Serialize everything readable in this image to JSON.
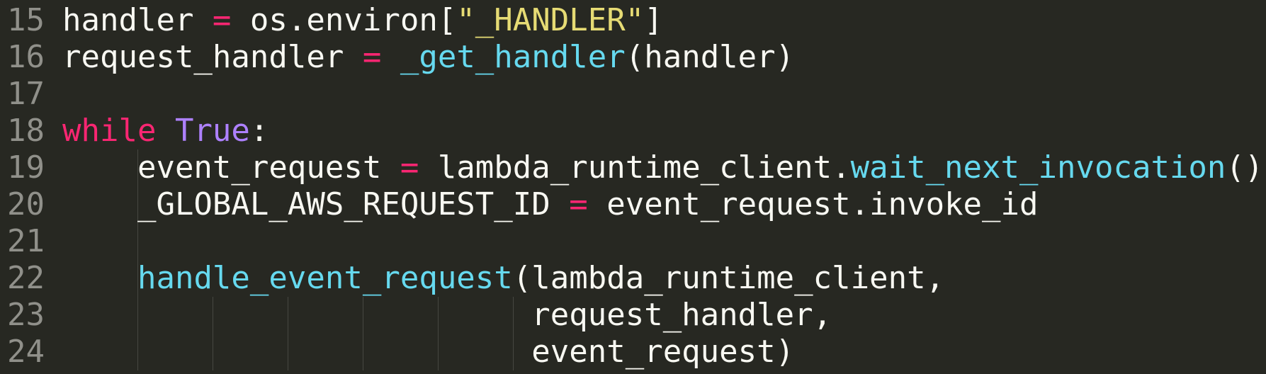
{
  "editor": {
    "theme_colors": {
      "background": "#272822",
      "keyword": "#f92672",
      "constant": "#ae81ff",
      "function": "#66d9ef",
      "string": "#e6db74",
      "text": "#f8f8f2",
      "gutter": "#90908a"
    },
    "lines": [
      {
        "number": "15",
        "guides": 0,
        "tokens": [
          {
            "t": "plain",
            "v": "handler "
          },
          {
            "t": "op",
            "v": "="
          },
          {
            "t": "plain",
            "v": " os.environ["
          },
          {
            "t": "str",
            "v": "\"_HANDLER\""
          },
          {
            "t": "plain",
            "v": "]"
          }
        ]
      },
      {
        "number": "16",
        "guides": 0,
        "tokens": [
          {
            "t": "plain",
            "v": "request_handler "
          },
          {
            "t": "op",
            "v": "="
          },
          {
            "t": "plain",
            "v": " "
          },
          {
            "t": "fn",
            "v": "_get_handler"
          },
          {
            "t": "plain",
            "v": "(handler)"
          }
        ]
      },
      {
        "number": "17",
        "guides": 0,
        "tokens": []
      },
      {
        "number": "18",
        "guides": 0,
        "tokens": [
          {
            "t": "kw",
            "v": "while"
          },
          {
            "t": "plain",
            "v": " "
          },
          {
            "t": "const",
            "v": "True"
          },
          {
            "t": "plain",
            "v": ":"
          }
        ]
      },
      {
        "number": "19",
        "guides": 1,
        "tokens": [
          {
            "t": "plain",
            "v": "    event_request "
          },
          {
            "t": "op",
            "v": "="
          },
          {
            "t": "plain",
            "v": " lambda_runtime_client."
          },
          {
            "t": "fn",
            "v": "wait_next_invocation"
          },
          {
            "t": "plain",
            "v": "()"
          }
        ]
      },
      {
        "number": "20",
        "guides": 1,
        "tokens": [
          {
            "t": "plain",
            "v": "    _GLOBAL_AWS_REQUEST_ID "
          },
          {
            "t": "op",
            "v": "="
          },
          {
            "t": "plain",
            "v": " event_request.invoke_id"
          }
        ]
      },
      {
        "number": "21",
        "guides": 1,
        "tokens": []
      },
      {
        "number": "22",
        "guides": 1,
        "tokens": [
          {
            "t": "plain",
            "v": "    "
          },
          {
            "t": "fn",
            "v": "handle_event_request"
          },
          {
            "t": "plain",
            "v": "(lambda_runtime_client,"
          }
        ]
      },
      {
        "number": "23",
        "guides": 6,
        "tokens": [
          {
            "t": "plain",
            "v": "                         request_handler,"
          }
        ]
      },
      {
        "number": "24",
        "guides": 6,
        "tokens": [
          {
            "t": "plain",
            "v": "                         event_request)"
          }
        ]
      }
    ]
  }
}
